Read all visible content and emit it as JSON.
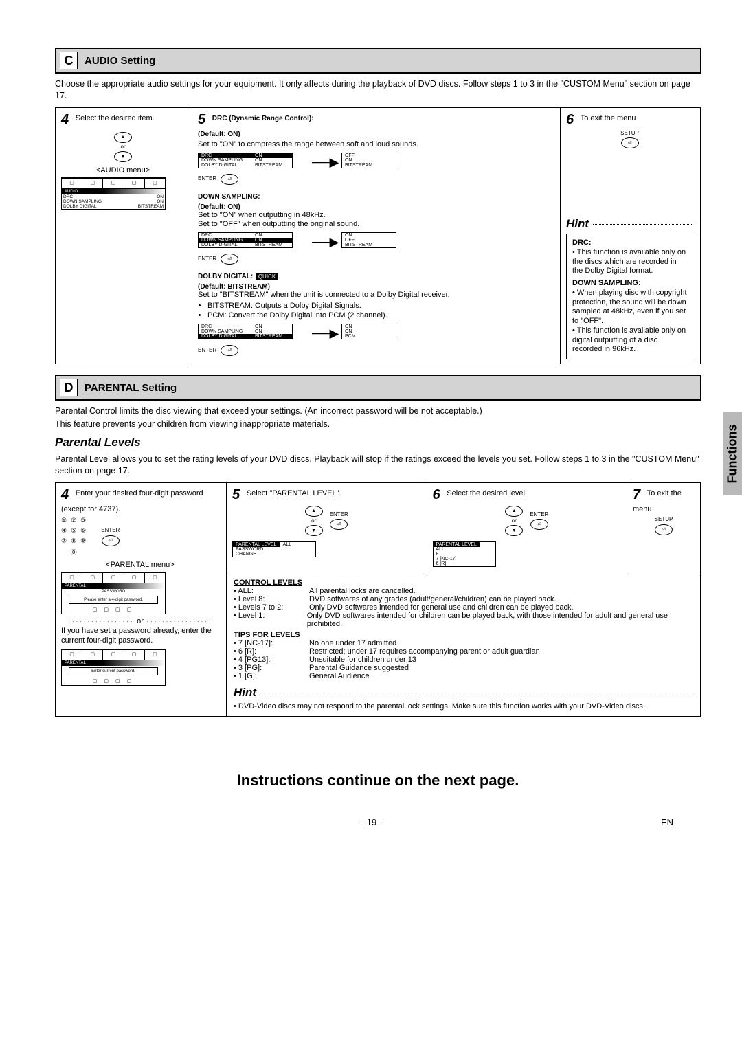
{
  "sections": {
    "c": {
      "letter": "C",
      "title": "AUDIO Setting",
      "intro": "Choose the appropriate audio settings for your equipment. It only affects during the playback of DVD discs. Follow steps 1 to 3 in the \"CUSTOM Menu\" section on page 17.",
      "step4": {
        "num": "4",
        "text": "Select the desired item.",
        "caption": "<AUDIO menu>"
      },
      "step5": {
        "num": "5",
        "drc": {
          "heading": "DRC (Dynamic Range Control):",
          "default": "(Default: ON)",
          "desc": "Set to \"ON\" to compress the range between soft and loud sounds."
        },
        "down": {
          "heading": "DOWN SAMPLING:",
          "default": "(Default: ON)",
          "desc1": "Set to \"ON\" when outputting in 48kHz.",
          "desc2": "Set to \"OFF\" when outputting the original sound."
        },
        "dolby": {
          "heading": "DOLBY DIGITAL:",
          "quick": "QUICK",
          "default": "(Default: BITSTREAM)",
          "desc": "Set to \"BITSTREAM\" when the unit is connected to a Dolby Digital receiver.",
          "b1": "BITSTREAM: Outputs a Dolby Digital Signals.",
          "b2": "PCM: Convert the Dolby Digital into PCM (2 channel)."
        },
        "mini_rows": {
          "r1": {
            "k": "DRC",
            "v": "ON"
          },
          "r2": {
            "k": "DOWN SAMPLING",
            "v": "ON"
          },
          "r3": {
            "k": "DOLBY DIGITAL",
            "v": "BITSTREAM"
          }
        },
        "alts": {
          "off": "OFF",
          "on": "ON",
          "bitstream": "BITSTREAM",
          "pcm": "PCM"
        },
        "enter": "ENTER"
      },
      "step6": {
        "num": "6",
        "text": "To exit the menu",
        "btn": "SETUP"
      },
      "menu": {
        "bar": "AUDIO",
        "rows": {
          "r1": {
            "k": "DRC",
            "v": "ON"
          },
          "r2": {
            "k": "DOWN SAMPLING",
            "v": "ON"
          },
          "r3": {
            "k": "DOLBY DIGITAL",
            "v": "BITSTREAM"
          }
        }
      },
      "hint": {
        "title": "Hint",
        "drc_h": "DRC:",
        "drc_t": "This function is available only on the discs which are recorded in the Dolby Digital format.",
        "down_h": "DOWN SAMPLING:",
        "down_t1": "When playing disc with copyright protection, the sound will be down sampled at 48kHz, even if you set to \"OFF\".",
        "down_t2": "This function is available only on digital outputting of a disc recorded in 96kHz."
      }
    },
    "d": {
      "letter": "D",
      "title": "PARENTAL Setting",
      "intro1": "Parental Control limits the disc viewing that exceed your settings. (An incorrect password will be not acceptable.)",
      "intro2": "This feature prevents your children from viewing inappropriate materials.",
      "sub": "Parental Levels",
      "sub_intro": "Parental Level allows you to set the rating levels of your DVD discs. Playback will stop if the ratings exceed the levels you set. Follow steps 1 to 3 in the \"CUSTOM Menu\" section on page 17.",
      "step4": {
        "num": "4",
        "text": "Enter your desired four-digit password (except for 4737).",
        "caption": "<PARENTAL menu>",
        "or": "or",
        "alt": "If you have set a password already, enter the current four-digit password.",
        "menu1": {
          "bar": "PARENTAL",
          "sub": "PASSWORD",
          "hint": "Please enter a 4-digit password."
        },
        "menu2": {
          "bar": "PARENTAL",
          "hint": "Enter current password."
        }
      },
      "step5": {
        "num": "5",
        "text": "Select \"PARENTAL LEVEL\".",
        "rows": {
          "r1": {
            "k": "PARENTAL LEVEL",
            "v": "ALL"
          },
          "r2": {
            "k": "PASSWORD CHANGE",
            "v": ""
          }
        }
      },
      "step6": {
        "num": "6",
        "text": "Select the desired level.",
        "rows": {
          "h": "PARENTAL LEVEL",
          "r1": "ALL",
          "r2": "8",
          "r3": "7 [NC-17]",
          "r4": "6 [R]"
        }
      },
      "step7": {
        "num": "7",
        "text": "To exit the menu",
        "btn": "SETUP"
      },
      "control": {
        "h": "CONTROL LEVELS",
        "l_all": {
          "k": "• ALL:",
          "v": "All parental locks are cancelled."
        },
        "l8": {
          "k": "• Level 8:",
          "v": "DVD softwares of any grades (adult/general/children) can be played back."
        },
        "l72": {
          "k": "• Levels 7 to 2:",
          "v": "Only DVD softwares intended for general use and children can be played back."
        },
        "l1": {
          "k": "• Level 1:",
          "v": "Only DVD softwares intended for children can be played back, with those intended for adult and general use prohibited."
        }
      },
      "tips": {
        "h": "TIPS FOR LEVELS",
        "t7": {
          "k": "• 7 [NC-17]:",
          "v": "No one under 17 admitted"
        },
        "t6": {
          "k": "• 6 [R]:",
          "v": "Restricted; under 17 requires accompanying parent or adult guardian"
        },
        "t4": {
          "k": "• 4 [PG13]:",
          "v": "Unsuitable for children under 13"
        },
        "t3": {
          "k": "• 3 [PG]:",
          "v": "Parental Guidance suggested"
        },
        "t1": {
          "k": "• 1 [G]:",
          "v": "General Audience"
        }
      },
      "hint": {
        "title": "Hint",
        "text": "DVD-Video discs may not respond to the parental lock settings. Make sure this function works with your DVD-Video discs."
      },
      "enter": "ENTER"
    }
  },
  "misc": {
    "or_word": "or",
    "arrow": "→"
  },
  "side": "Functions",
  "continue": "Instructions continue on the next page.",
  "footer": {
    "page": "– 19 –",
    "lang": "EN"
  }
}
